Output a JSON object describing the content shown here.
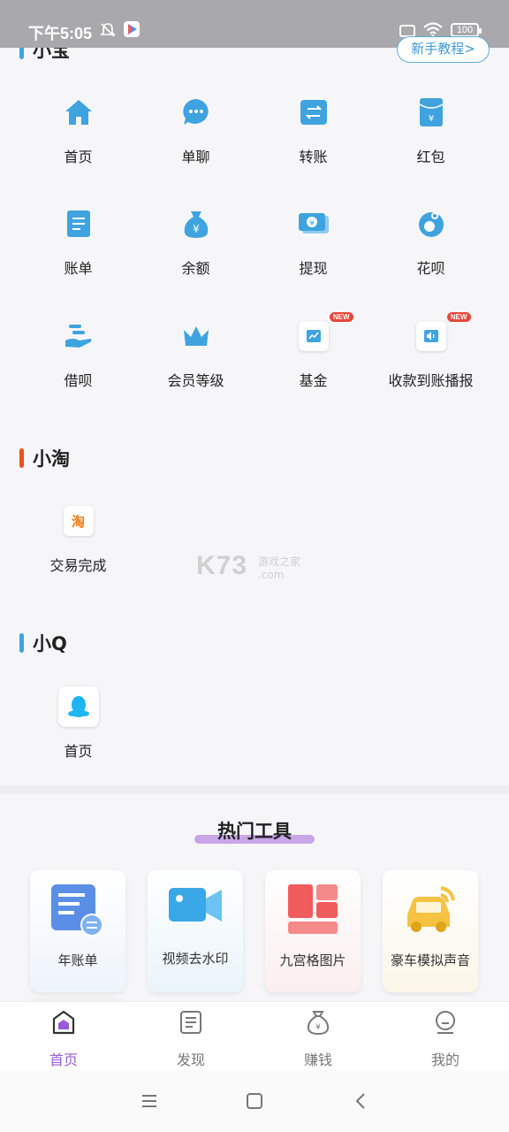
{
  "status_bar": {
    "time": "下午5:05",
    "battery": "100"
  },
  "tutorial_button": "新手教程>",
  "sections": {
    "xiaobao": {
      "title": "小宝",
      "bar_color": "#3fa3e0",
      "items": [
        {
          "label": "首页",
          "icon": "home-icon"
        },
        {
          "label": "单聊",
          "icon": "chat-icon"
        },
        {
          "label": "转账",
          "icon": "transfer-icon"
        },
        {
          "label": "红包",
          "icon": "red-packet-icon"
        },
        {
          "label": "账单",
          "icon": "bill-icon"
        },
        {
          "label": "余额",
          "icon": "balance-bag-icon"
        },
        {
          "label": "提现",
          "icon": "withdraw-icon"
        },
        {
          "label": "花呗",
          "icon": "huabei-icon"
        },
        {
          "label": "借呗",
          "icon": "jiebei-icon"
        },
        {
          "label": "会员等级",
          "icon": "crown-icon"
        },
        {
          "label": "基金",
          "icon": "fund-chart-icon",
          "badge": "NEW"
        },
        {
          "label": "收款到账播报",
          "icon": "speaker-icon",
          "badge": "NEW"
        }
      ]
    },
    "xiaotao": {
      "title": "小淘",
      "bar_color": "#e8531f",
      "items": [
        {
          "label": "交易完成",
          "icon": "taobao-icon",
          "icon_text": "淘"
        }
      ]
    },
    "xiaoq": {
      "title": "小Q",
      "bar_color": "#3fa3e0",
      "items": [
        {
          "label": "首页",
          "icon": "qq-penguin-icon"
        }
      ]
    }
  },
  "watermark": {
    "main": "K73",
    "sub": "游戏之家",
    "domain": ".com"
  },
  "tools": {
    "title": "热门工具",
    "items": [
      {
        "label": "年账单",
        "icon": "annual-bill-icon"
      },
      {
        "label": "视频去水印",
        "icon": "video-camera-icon"
      },
      {
        "label": "九宫格图片",
        "icon": "grid-image-icon"
      },
      {
        "label": "豪车模拟声音",
        "icon": "car-sound-icon"
      }
    ]
  },
  "bottom_nav": [
    {
      "label": "首页",
      "icon": "home-nav-icon",
      "active": true
    },
    {
      "label": "发现",
      "icon": "discover-icon",
      "active": false
    },
    {
      "label": "赚钱",
      "icon": "money-bag-icon",
      "active": false
    },
    {
      "label": "我的",
      "icon": "profile-icon",
      "active": false
    }
  ],
  "colors": {
    "accent": "#3fa3e0",
    "active_nav": "#9a5bd6",
    "badge": "#e6473a"
  }
}
